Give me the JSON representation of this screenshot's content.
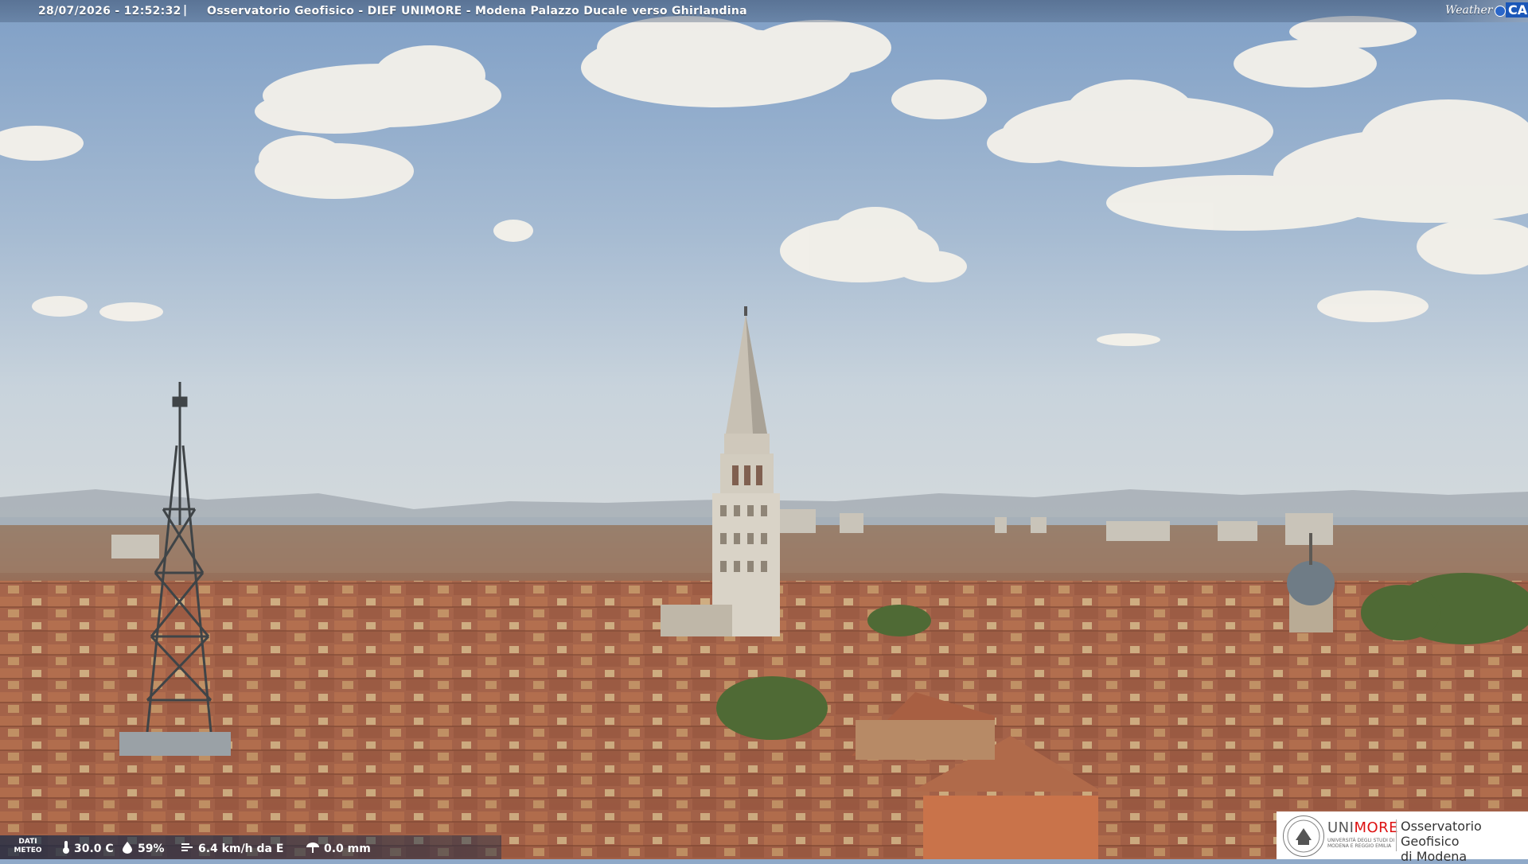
{
  "overlay": {
    "timestamp": "28/07/2026 - 12:52:32",
    "separator": "|",
    "title": "Osservatorio Geofisico - DIEF UNIMORE - Modena Palazzo Ducale verso Ghirlandina"
  },
  "brand": {
    "weather": "Weather",
    "cam": "CAM"
  },
  "meteo": {
    "label_line1": "DATI",
    "label_line2": "METEO",
    "temperature": "30.0 C",
    "humidity": "59%",
    "wind": "6.4 km/h da E",
    "rain": "0.0 mm",
    "icons": [
      "thermometer-icon",
      "humidity-drop-icon",
      "wind-icon",
      "rain-icon"
    ]
  },
  "logo": {
    "uni_prefix": "UNI",
    "uni_suffix": "MORE",
    "uni_sub": "UNIVERSITÀ DEGLI STUDI DI MODENA E REGGIO EMILIA",
    "obs_line1": "Osservatorio Geofisico",
    "obs_line2": "di Modena",
    "accent": "#d11111"
  },
  "colors": {
    "sky": "#8fa9c8",
    "roof": "#b0674a",
    "tower": "#d9d3c7"
  }
}
